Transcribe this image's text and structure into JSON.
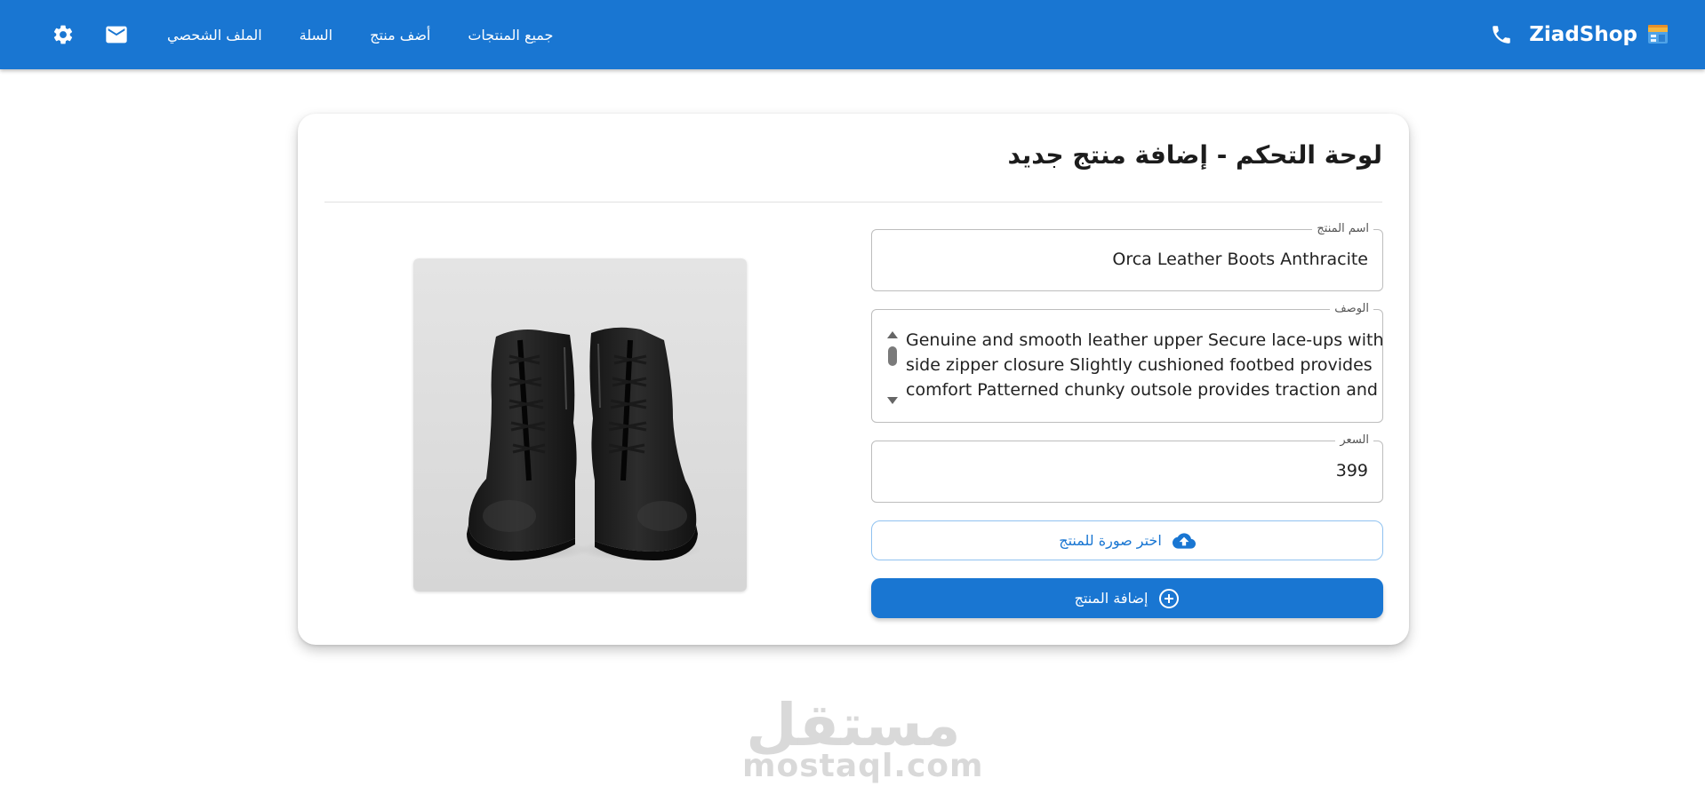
{
  "header": {
    "brand_name": "ZiadShop",
    "nav": {
      "all_products": "جميع المنتجات",
      "add_product": "أضف منتج",
      "cart": "السلة",
      "profile": "الملف الشحصي"
    },
    "icons": [
      "settings-icon",
      "mail-icon",
      "phone-icon",
      "shop-logo-icon"
    ],
    "background_color": "#1976d2"
  },
  "card": {
    "title": "لوحة التحكم - إضافة منتج جديد",
    "fields": {
      "name": {
        "label": "اسم المنتج",
        "value": "Orca Leather Boots Anthracite"
      },
      "description": {
        "label": "الوصف",
        "lines": [
          "Genuine and smooth leather upper Secure lace-ups with",
          "side zipper closure Slightly cushioned footbed provides",
          "comfort Patterned chunky outsole provides traction and"
        ]
      },
      "price": {
        "label": "السعر",
        "value": "399"
      }
    },
    "upload_button": {
      "label": "اختر صورة للمنتج",
      "icon": "cloud-upload-icon"
    },
    "submit_button": {
      "label": "إضافة المنتج",
      "icon": "add-circle-icon"
    },
    "image": {
      "alt": "black leather lace-up boots"
    },
    "accent_color": "#1976d2"
  },
  "watermark": {
    "arabic": "مستقل",
    "latin": "mostaql.com"
  }
}
